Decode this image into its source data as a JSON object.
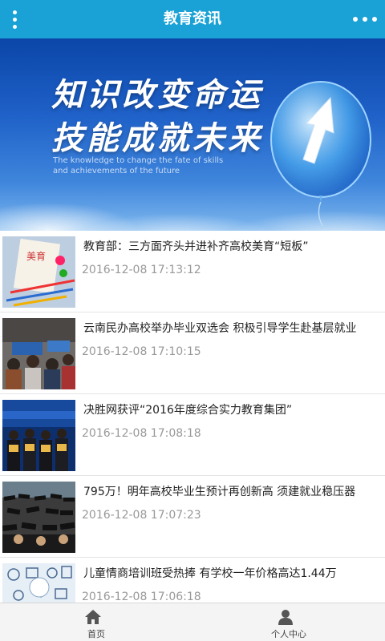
{
  "header": {
    "title": "教育资讯",
    "menu_icon": "vertical-dots-icon",
    "more_icon": "horizontal-dots-icon"
  },
  "banner": {
    "slogan_line1": "知识改变命运",
    "slogan_line2": "技能成就未来",
    "subtitle": "The knowledge to change the fate of skills and achievements of the future",
    "slides": 3,
    "active_slide": 1
  },
  "news": [
    {
      "title": "教育部：三方面齐头并进补齐高校美育“短板”",
      "time": "2016-12-08 17:13:12",
      "thumb_text": "美育"
    },
    {
      "title": "云南民办高校举办毕业双选会 积极引导学生赴基层就业",
      "time": "2016-12-08 17:10:15"
    },
    {
      "title": "决胜网获评“2016年度综合实力教育集团”",
      "time": "2016-12-08 17:08:18"
    },
    {
      "title": "795万！明年高校毕业生预计再创新高 须建就业稳压器",
      "time": "2016-12-08 17:07:23"
    },
    {
      "title": "儿童情商培训班受热捧 有学校一年价格高达1.44万",
      "time": "2016-12-08 17:06:18"
    }
  ],
  "tabs": [
    {
      "label": "首页",
      "icon": "home-icon"
    },
    {
      "label": "个人中心",
      "icon": "user-icon"
    }
  ],
  "colors": {
    "accent": "#1aa2d6",
    "time_text": "#999999"
  }
}
